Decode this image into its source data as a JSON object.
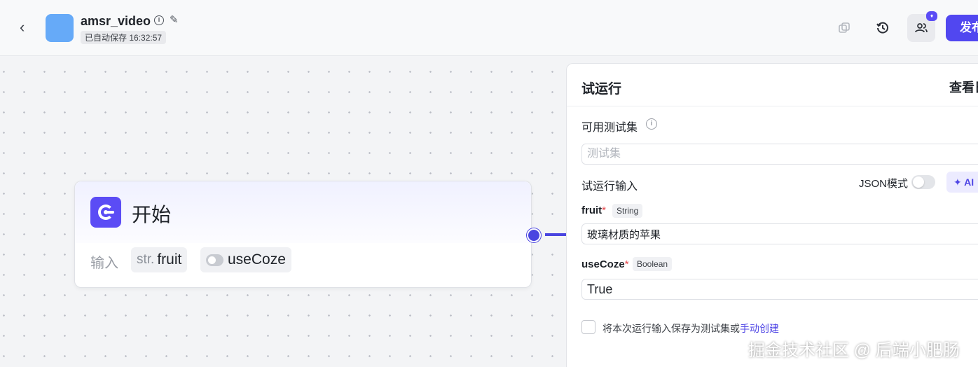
{
  "header": {
    "title": "amsr_video",
    "autosave": "已自动保存 16:32:57",
    "publish_label": "发布"
  },
  "node": {
    "title": "开始",
    "inputs_label": "输入",
    "params": [
      {
        "prefix": "str.",
        "name": "fruit"
      },
      {
        "prefix": "",
        "name": "useCoze"
      }
    ]
  },
  "panel": {
    "title": "试运行",
    "header_link": "查看日志",
    "testset_label": "可用测试集",
    "testset_placeholder": "测试集",
    "run_input_label": "试运行输入",
    "json_mode_label": "JSON模式",
    "ai_button_label": "AI",
    "fields": [
      {
        "name": "fruit",
        "required": "*",
        "type": "String",
        "value": "玻璃材质的苹果"
      },
      {
        "name": "useCoze",
        "required": "*",
        "type": "Boolean",
        "value": "True"
      }
    ],
    "save_text": "将本次运行输入保存为测试集或",
    "save_link": "手动创建"
  },
  "watermark": "掘金技术社区 @ 后端小肥肠",
  "colors": {
    "accent": "#5147f0",
    "node_icon": "#5b4cf5",
    "app_icon": "#66aaf8"
  },
  "icons": [
    "back-icon",
    "info-icon",
    "edit-icon",
    "copy-icon",
    "history-icon",
    "collaborators-icon",
    "ai-sparkle-icon"
  ]
}
